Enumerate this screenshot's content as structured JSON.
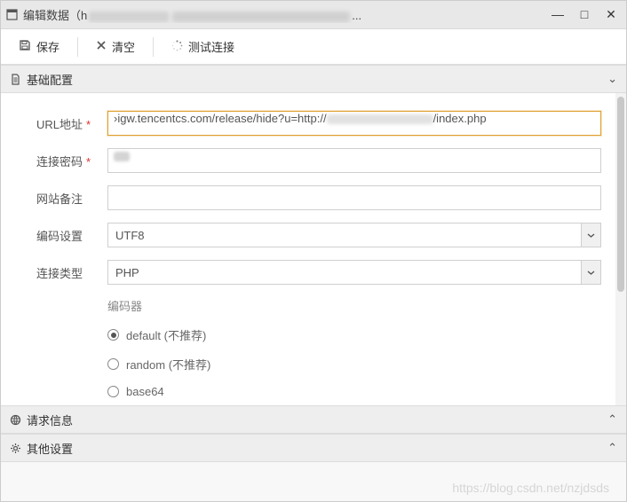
{
  "window": {
    "title_prefix": "编辑数据（h",
    "title_suffix": "...",
    "minimize": "—",
    "maximize": "□",
    "close": "✕"
  },
  "toolbar": {
    "save_label": "保存",
    "clear_label": "清空",
    "test_label": "测试连接"
  },
  "panels": {
    "basic": {
      "title": "基础配置",
      "chev": "⌄"
    },
    "request": {
      "title": "请求信息",
      "chev": "⌃"
    },
    "other": {
      "title": "其他设置",
      "chev": "⌃"
    }
  },
  "form": {
    "url_label": "URL地址",
    "url_pre": "›igw.tencentcs.com/release/hide?u=http://",
    "url_post": "/index.php",
    "password_label": "连接密码",
    "note_label": "网站备注",
    "encoding_label": "编码设置",
    "encoding_value": "UTF8",
    "conn_type_label": "连接类型",
    "conn_type_value": "PHP",
    "required": "*"
  },
  "encoder": {
    "title": "编码器",
    "options": [
      {
        "label": "default (不推荐)",
        "checked": true
      },
      {
        "label": "random (不推荐)",
        "checked": false
      },
      {
        "label": "base64",
        "checked": false
      }
    ]
  },
  "watermark": "https://blog.csdn.net/nzjdsds"
}
